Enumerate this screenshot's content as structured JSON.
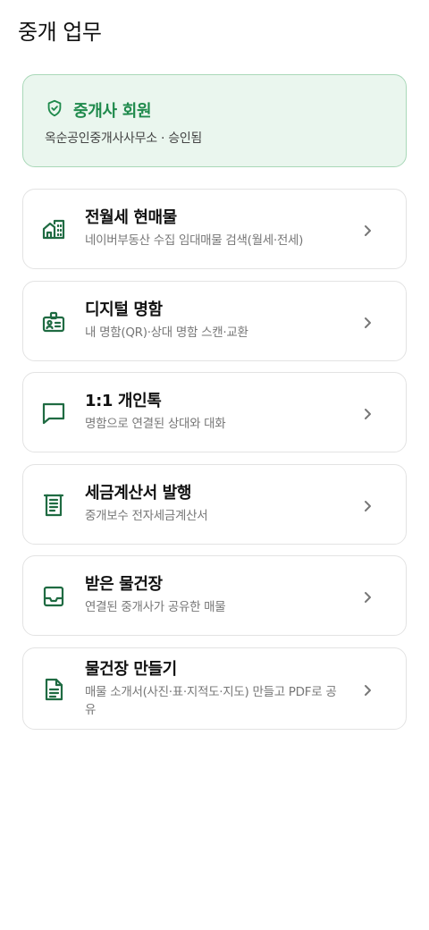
{
  "header": {
    "title": "중개 업무"
  },
  "member": {
    "title": "중개사 회원",
    "subtitle": "옥순공인중개사사무소 · 승인됨",
    "icon": "shield-check-icon",
    "accent": "#1f8a4c"
  },
  "menu": [
    {
      "title": "전월세 현매물",
      "desc": "네이버부동산 수집 임대매물 검색(월세·전세)",
      "icon": "building-icon"
    },
    {
      "title": "디지털 명함",
      "desc": "내 명함(QR)·상대 명함 스캔·교환",
      "icon": "id-badge-icon"
    },
    {
      "title": "1:1 개인톡",
      "desc": "명함으로 연결된 상대와 대화",
      "icon": "chat-bubble-icon"
    },
    {
      "title": "세금계산서 발행",
      "desc": "중개보수 전자세금계산서",
      "icon": "receipt-icon"
    },
    {
      "title": "받은 물건장",
      "desc": "연결된 중개사가 공유한 매물",
      "icon": "inbox-icon"
    },
    {
      "title": "물건장 만들기",
      "desc": "매물 소개서(사진·표·지적도·지도) 만들고 PDF로 공유",
      "icon": "document-icon"
    }
  ]
}
